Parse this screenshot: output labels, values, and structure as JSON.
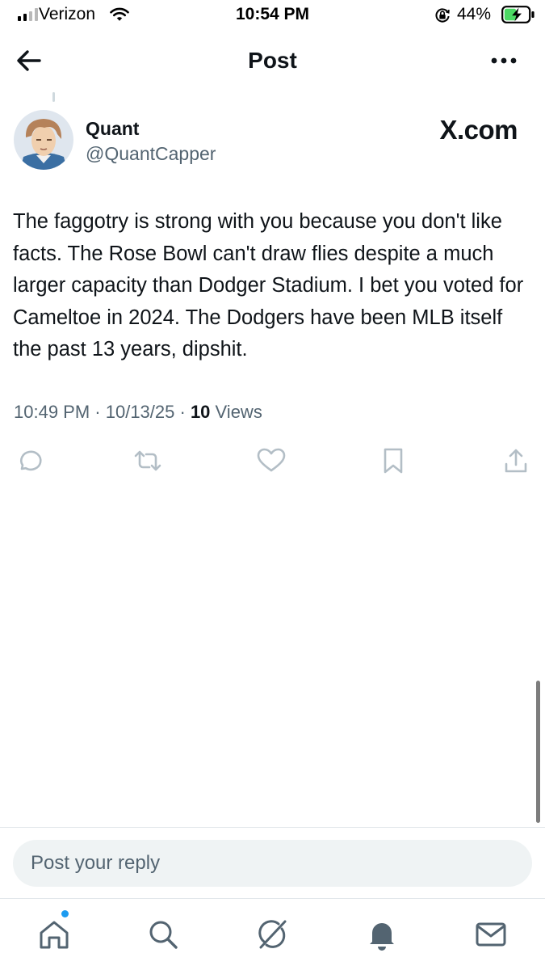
{
  "status_bar": {
    "carrier": "Verizon",
    "time": "10:54 PM",
    "battery_percent": "44%",
    "signal_bars": 2,
    "signal_bars_total": 4
  },
  "header": {
    "title": "Post",
    "back_icon": "arrow-left-icon",
    "more_icon": "more-horizontal-icon"
  },
  "post": {
    "author_name": "Quant",
    "author_handle": "@QuantCapper",
    "brand_watermark": "X.com",
    "text": "The faggotry is strong with you because you don't like facts. The Rose Bowl can't draw flies despite a much larger capacity than Dodger Stadium. I bet you voted for Cameltoe in 2024. The Dodgers have been MLB itself the past 13 years, dipshit.",
    "time": "10:49 PM",
    "separator": " · ",
    "date": "10/13/25",
    "views_count": "10",
    "views_label": " Views"
  },
  "actions": {
    "icons": [
      "reply-icon",
      "repost-icon",
      "like-icon",
      "bookmark-icon",
      "share-icon"
    ]
  },
  "reply": {
    "placeholder": "Post your reply"
  },
  "tabbar": {
    "icons": [
      "home-icon",
      "search-icon",
      "grok-icon",
      "notifications-icon",
      "messages-icon"
    ]
  },
  "colors": {
    "text_primary": "#0f1419",
    "text_secondary": "#536471",
    "icon_muted": "#b3bec6",
    "accent": "#1d9bf0",
    "battery_green": "#4cd964",
    "reply_bg": "#eff3f4"
  }
}
